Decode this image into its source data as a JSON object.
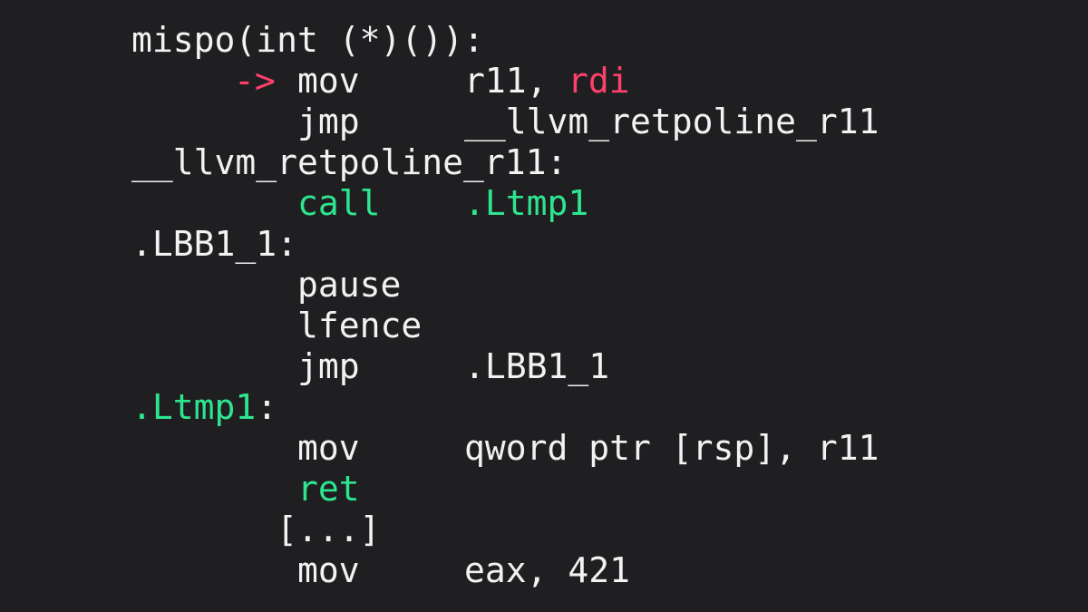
{
  "code": {
    "lines": [
      {
        "label": "mispo(int (*)()):"
      },
      {
        "arrow": "->",
        "op": "mov",
        "arg1": "r11,",
        "arg2": "rdi"
      },
      {
        "op": "jmp",
        "arg": "__llvm_retpoline_r11"
      },
      {
        "label": "__llvm_retpoline_r11:"
      },
      {
        "op": "call",
        "arg": ".Ltmp1"
      },
      {
        "label": ".LBB1_1:"
      },
      {
        "op": "pause"
      },
      {
        "op": "lfence"
      },
      {
        "op": "jmp",
        "arg": ".LBB1_1"
      },
      {
        "label": ".Ltmp1",
        "colon": ":"
      },
      {
        "op": "mov",
        "arg": "qword ptr [rsp], r11"
      },
      {
        "op": "ret"
      },
      {
        "label": "[...]"
      },
      {
        "op": "mov",
        "arg": "eax, 421"
      }
    ]
  },
  "colors": {
    "background": "#1f1f21",
    "text": "#f2f2f2",
    "green": "#2ee58f",
    "red": "#ff3f6c"
  }
}
